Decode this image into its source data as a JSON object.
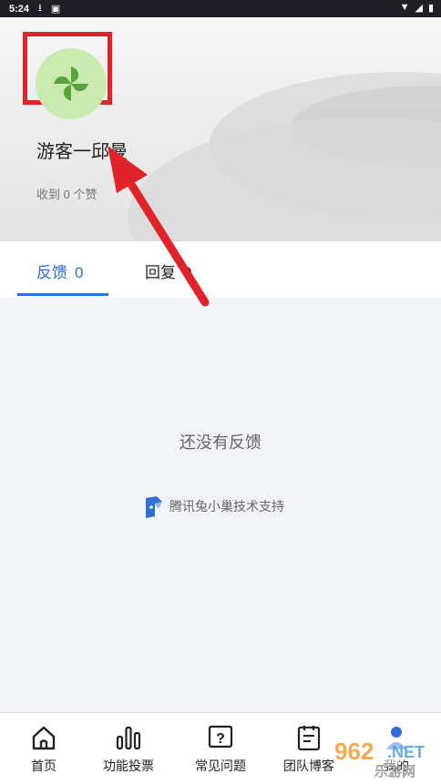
{
  "status_bar": {
    "time": "5:24"
  },
  "profile": {
    "username": "游客一邱曼",
    "likes_text": "收到 0 个赞"
  },
  "tabs": [
    {
      "label": "反馈",
      "count": "0"
    },
    {
      "label": "回复",
      "count": "0"
    }
  ],
  "empty_state": {
    "message": "还没有反馈"
  },
  "support": {
    "text": "腾讯兔小巢技术支持"
  },
  "bottom_nav": [
    {
      "label": "首页",
      "icon": "home-icon"
    },
    {
      "label": "功能投票",
      "icon": "bar-chart-icon"
    },
    {
      "label": "常见问题",
      "icon": "question-icon"
    },
    {
      "label": "团队博客",
      "icon": "document-icon"
    },
    {
      "label": "我的",
      "icon": "user-icon"
    }
  ],
  "colors": {
    "accent": "#2f6fd6",
    "highlight": "#e0232a",
    "avatar_bg": "#c9ebb0",
    "avatar_leaf": "#5aa23c"
  }
}
